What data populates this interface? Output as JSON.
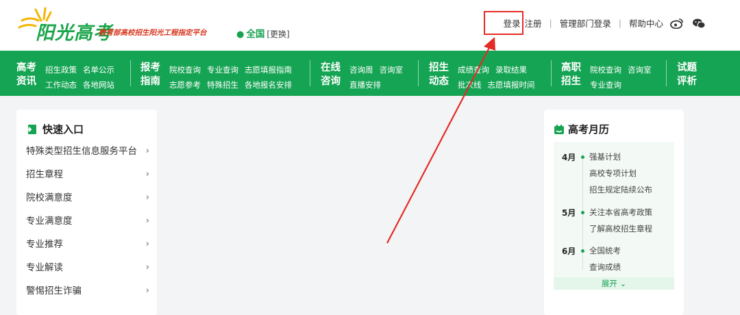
{
  "header": {
    "logo_title": "阳光高考",
    "logo_subtitle": "教育部高校招生阳光工程指定平台",
    "region": "全国",
    "region_change": "[更换]",
    "links": {
      "login": "登录",
      "register": "注册",
      "admin_login": "管理部门登录",
      "help": "帮助中心"
    }
  },
  "nav": [
    {
      "title_top": "高考",
      "title_bottom": "资讯",
      "row1": [
        "招生政策",
        "名单公示"
      ],
      "row2": [
        "工作动态",
        "各地网站"
      ]
    },
    {
      "title_top": "报考",
      "title_bottom": "指南",
      "row1": [
        "院校查询",
        "专业查询",
        "志愿填报指南"
      ],
      "row2": [
        "志愿参考",
        "特殊招生",
        "各地报名安排"
      ]
    },
    {
      "title_top": "在线",
      "title_bottom": "咨询",
      "row1": [
        "咨询周",
        "咨询室"
      ],
      "row2": [
        "直播安排"
      ]
    },
    {
      "title_top": "招生",
      "title_bottom": "动态",
      "row1": [
        "成绩查询",
        "录取结果"
      ],
      "row2": [
        "批次线",
        "志愿填报时间"
      ]
    },
    {
      "title_top": "高职",
      "title_bottom": "招生",
      "row1": [
        "院校查询",
        "咨询室"
      ],
      "row2": [
        "专业查询"
      ]
    },
    {
      "title_top": "试题",
      "title_bottom": "评析",
      "row1": [],
      "row2": []
    }
  ],
  "quick": {
    "title": "快速入口",
    "items": [
      "特殊类型招生信息服务平台",
      "招生章程",
      "院校满意度",
      "专业满意度",
      "专业推荐",
      "专业解读",
      "警惕招生诈骗"
    ]
  },
  "calendar": {
    "title": "高考月历",
    "months": [
      {
        "month": "4月",
        "items": [
          "强基计划",
          "高校专项计划",
          "招生规定陆续公布"
        ]
      },
      {
        "month": "5月",
        "items": [
          "关注本省高考政策",
          "了解高校招生章程"
        ]
      },
      {
        "month": "6月",
        "items": [
          "全国统考",
          "查询成绩"
        ]
      }
    ],
    "expand": "展开"
  },
  "colors": {
    "brand_green": "#15a453",
    "highlight_red": "#e42b24",
    "subtitle_red": "#d9361e"
  }
}
